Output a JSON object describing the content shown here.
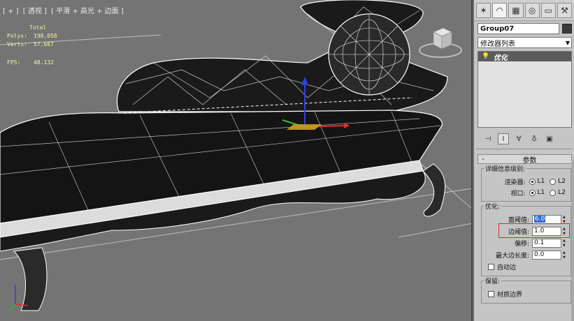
{
  "viewport": {
    "label_parts": [
      "[ + ]",
      "[ 透视 ]",
      "[ 平滑 + 高光 + 边面 ]"
    ],
    "stats": {
      "total_label": "Total",
      "polys_label": "Polys:",
      "polys_value": "198,058",
      "verts_label": "Verts:",
      "verts_value": "57,687",
      "fps_label": "FPS:",
      "fps_value": "48.132"
    },
    "gizmo_colors": {
      "x": "#e03030",
      "y": "#30c030",
      "z": "#3040e0"
    }
  },
  "command_panel": {
    "tabs": [
      {
        "icon": "create-icon",
        "glyph": "✶"
      },
      {
        "icon": "modify-icon",
        "glyph": "◠"
      },
      {
        "icon": "hierarchy-icon",
        "glyph": "▦"
      },
      {
        "icon": "motion-icon",
        "glyph": "◎"
      },
      {
        "icon": "display-icon",
        "glyph": "▭"
      },
      {
        "icon": "utilities-icon",
        "glyph": "⚒"
      }
    ],
    "object_name": "Group07",
    "object_color": "#3a3a3a",
    "modifier_list_label": "修改器列表",
    "stack_items": [
      "优化"
    ],
    "stack_tools": [
      {
        "icon": "pin-stack-icon",
        "glyph": "⊣"
      },
      {
        "icon": "show-end-result-icon",
        "glyph": "I"
      },
      {
        "icon": "make-unique-icon",
        "glyph": "∀"
      },
      {
        "icon": "remove-modifier-icon",
        "glyph": "♁"
      },
      {
        "icon": "configure-modifier-sets-icon",
        "glyph": "▣"
      }
    ],
    "rollout_title": "参数",
    "detail_group_title": "详细信息级别:",
    "renderer_label": "渲染器:",
    "viewport_label": "视口:",
    "l1": "L1",
    "l2": "L2",
    "optimize_group_title": "优化:",
    "face_threshold_label": "面阈值:",
    "face_threshold_value": "6.0",
    "edge_threshold_label": "边阈值:",
    "edge_threshold_value": "1.0",
    "bias_label": "偏移:",
    "bias_value": "0.1",
    "max_edge_len_label": "最大边长度:",
    "max_edge_len_value": "0.0",
    "auto_edge_label": "自动边",
    "preserve_group_title": "保留:",
    "material_boundary_label": "材质边界"
  }
}
